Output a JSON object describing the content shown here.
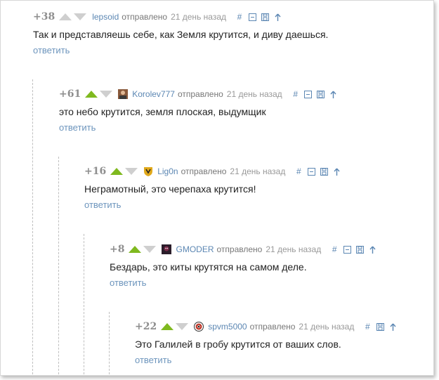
{
  "colors": {
    "upvote_active": "#7fb91f",
    "vote_inactive": "#cfcfcf",
    "link": "#5c87b3",
    "reply_link": "#6d95bd",
    "rating": "#8f8f8f"
  },
  "comments": [
    {
      "rating": "+38",
      "upvoted": false,
      "avatar_icon": "",
      "username": "lepsoid",
      "sent_label": "отправлено",
      "time": "21 день назад",
      "actions": [
        "hash-icon",
        "collapse-icon",
        "save-icon",
        "parent-arrow-icon"
      ],
      "text": "Так и представляешь себе, как Земля крутится, и диву даешься.",
      "reply_label": "ответить"
    },
    {
      "rating": "+61",
      "upvoted": true,
      "avatar_icon": "person-avatar-icon",
      "username": "Korolev777",
      "sent_label": "отправлено",
      "time": "21 день назад",
      "actions": [
        "hash-icon",
        "collapse-icon",
        "save-icon",
        "parent-arrow-icon"
      ],
      "text": "это небо крутится, земля плоская, выдумщик",
      "reply_label": "ответить"
    },
    {
      "rating": "+16",
      "upvoted": true,
      "avatar_icon": "shield-avatar-icon",
      "username": "Lig0n",
      "sent_label": "отправлено",
      "time": "21 день назад",
      "actions": [
        "hash-icon",
        "collapse-icon",
        "save-icon",
        "parent-arrow-icon"
      ],
      "text": "Неграмотный, это черепаха крутится!",
      "reply_label": "ответить"
    },
    {
      "rating": "+8",
      "upvoted": true,
      "avatar_icon": "dark-avatar-icon",
      "username": "GMODER",
      "sent_label": "отправлено",
      "time": "21 день назад",
      "actions": [
        "hash-icon",
        "collapse-icon",
        "save-icon",
        "parent-arrow-icon"
      ],
      "text": "Бездарь, это киты крутятся на самом деле.",
      "reply_label": "ответить"
    },
    {
      "rating": "+22",
      "upvoted": true,
      "avatar_icon": "target-avatar-icon",
      "username": "spvm5000",
      "sent_label": "отправлено",
      "time": "21 день назад",
      "actions": [
        "hash-icon",
        "save-icon",
        "parent-arrow-icon"
      ],
      "text": "Это Галилей в гробу крутится от ваших слов.",
      "reply_label": "ответить"
    }
  ]
}
